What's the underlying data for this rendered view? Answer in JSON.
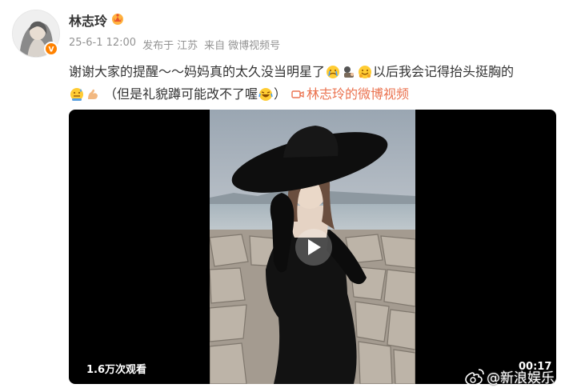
{
  "user": {
    "name": "林志玲",
    "avatar_icon": "avatar-photo",
    "vip_icon": "crown-icon",
    "verified_icon": "verified-badge-icon"
  },
  "meta": {
    "date": "25-6-1 12:00",
    "published_label": "发布于",
    "location": "江苏",
    "source_label": "来自",
    "source": "微博视频号"
  },
  "post": {
    "line1_a": "谢谢大家的提醒～～妈妈真的太久没当明星了",
    "line1_b": "以后我会记得抬头挺胸的",
    "line2_a": "（但是礼貌蹲可能改不了喔",
    "line2_b": "）",
    "video_link": "林志玲的微博视频",
    "emojis": [
      "crying-face",
      "bowing-person",
      "hugging-face",
      "sweating-face",
      "flexed-biceps",
      "laughing-face"
    ]
  },
  "video": {
    "play_count": "1.6万次观看",
    "duration": "00:17"
  },
  "watermark": {
    "text": "@新浪娱乐",
    "icon": "weibo-logo-icon"
  },
  "colors": {
    "accent": "#ff8200",
    "link": "#eb7350",
    "meta": "#939393",
    "text": "#333333"
  }
}
